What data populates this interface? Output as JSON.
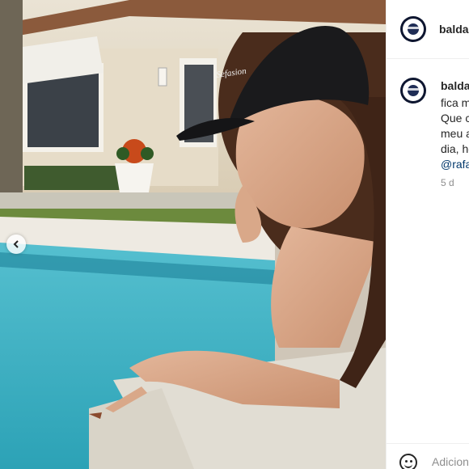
{
  "post": {
    "username": "baldac",
    "caption_lines": [
      "fica m",
      "Que c",
      "meu a",
      "dia, ho"
    ],
    "mention": "@rafa",
    "timestamp": "5 d"
  },
  "comment": {
    "placeholder": "Adicion"
  },
  "icons": {
    "prev": "chevron-left-icon",
    "emoji": "emoji-icon",
    "avatar": "profile-avatar"
  },
  "photo": {
    "cap_text": "Sefasion"
  }
}
